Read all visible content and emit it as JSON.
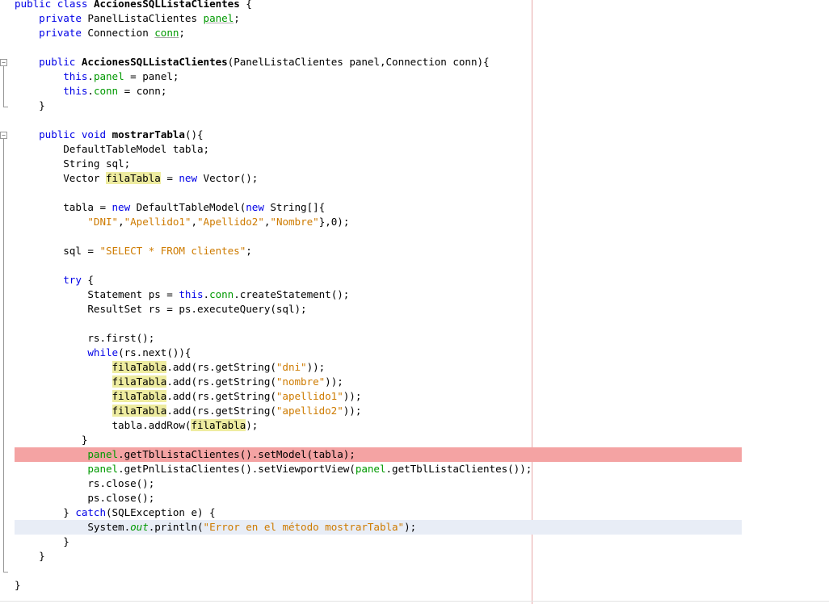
{
  "editor": {
    "language": "java",
    "lines": [
      "public class AccionesSQLListaClientes {",
      "    private PanelListaClientes panel;",
      "    private Connection conn;",
      "",
      "    public AccionesSQLListaClientes(PanelListaClientes panel,Connection conn){",
      "        this.panel = panel;",
      "        this.conn = conn;",
      "    }",
      "",
      "    public void mostrarTabla(){",
      "        DefaultTableModel tabla;",
      "        String sql;",
      "        Vector filaTabla = new Vector();",
      "",
      "        tabla = new DefaultTableModel(new String[]{",
      "            \"DNI\",\"Apellido1\",\"Apellido2\",\"Nombre\"},0);",
      "",
      "        sql = \"SELECT * FROM clientes\";",
      "",
      "        try {",
      "            Statement ps = this.conn.createStatement();",
      "            ResultSet rs = ps.executeQuery(sql);",
      "",
      "            rs.first();",
      "            while(rs.next()){",
      "                filaTabla.add(rs.getString(\"dni\"));",
      "                filaTabla.add(rs.getString(\"nombre\"));",
      "                filaTabla.add(rs.getString(\"apellido1\"));",
      "                filaTabla.add(rs.getString(\"apellido2\"));",
      "                tabla.addRow(filaTabla);",
      "           }",
      "            panel.getTblListaClientes().setModel(tabla);",
      "            panel.getPnlListaClientes().setViewportView(panel.getTblListaClientes());",
      "            rs.close();",
      "            ps.close();",
      "        } catch(SQLException e) {",
      "            System.out.println(\"Error en el método mostrarTabla\");",
      "        }",
      "    }",
      "",
      "}"
    ],
    "error_line": 32,
    "current_line": 37,
    "fold_markers": [
      5,
      10
    ],
    "colors": {
      "keyword": "#0000e6",
      "field": "#009900",
      "string": "#ce7b00",
      "occurrence_mark": "#eeeca0",
      "error_highlight": "#f4a3a3",
      "current_line_highlight": "#e8edf6",
      "right_margin": "#e8a8a8"
    }
  }
}
